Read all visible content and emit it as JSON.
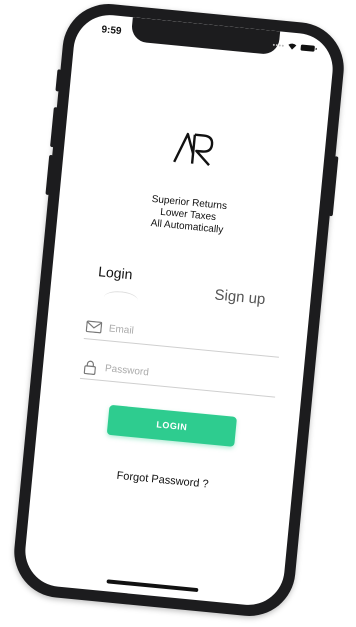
{
  "status_bar": {
    "time": "9:59",
    "icons": [
      "signal-dots-icon",
      "wifi-icon",
      "battery-icon"
    ]
  },
  "brand": {
    "logo_text": "AR",
    "tagline": [
      "Superior Returns",
      "Lower Taxes",
      "All Automatically"
    ]
  },
  "tabs": {
    "login_label": "Login",
    "signup_label": "Sign up",
    "active": "Login"
  },
  "form": {
    "email_placeholder": "Email",
    "email_value": "",
    "password_placeholder": "Password",
    "password_value": "",
    "submit_label": "LOGIN",
    "forgot_label": "Forgot Password ?"
  },
  "colors": {
    "accent": "#2ecc8f",
    "phone_frame": "#1c1c1e",
    "text": "#111111",
    "placeholder": "#aaaaaa"
  }
}
